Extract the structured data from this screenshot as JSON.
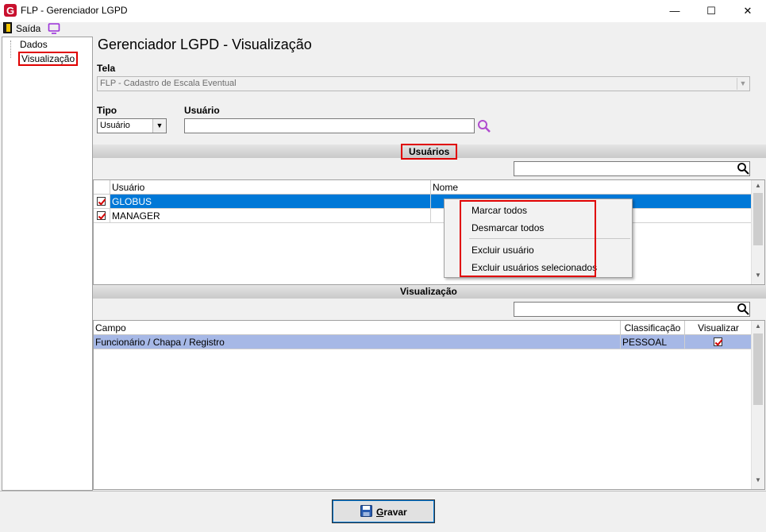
{
  "window": {
    "title": "FLP - Gerenciador LGPD",
    "minimize": "—",
    "maximize": "☐",
    "close": "✕"
  },
  "toolbar": {
    "exit_label": "Saída",
    "exit_icon": "exit-door-icon",
    "monitor_icon": "monitor-icon"
  },
  "tree": {
    "items": [
      {
        "label": "Dados",
        "selected": false
      },
      {
        "label": "Visualização",
        "selected": true
      }
    ]
  },
  "page": {
    "title": "Gerenciador LGPD - Visualização"
  },
  "form": {
    "tela_label": "Tela",
    "tela_value": "FLP - Cadastro de Escala Eventual",
    "tipo_label": "Tipo",
    "tipo_value": "Usuário",
    "usuario_label": "Usuário",
    "usuario_value": ""
  },
  "usuarios_section": {
    "title": "Usuários",
    "search_value": "",
    "columns": [
      "Usuário",
      "Nome"
    ],
    "rows": [
      {
        "checked": true,
        "usuario": "GLOBUS",
        "nome": "",
        "selected": true
      },
      {
        "checked": true,
        "usuario": "MANAGER",
        "nome": "",
        "selected": false
      }
    ]
  },
  "context_menu": {
    "items": [
      "Marcar todos",
      "Desmarcar todos",
      "Excluir usuário",
      "Excluir usuários selecionados"
    ]
  },
  "visualizacao_section": {
    "title": "Visualização",
    "search_value": "",
    "columns": [
      "Campo",
      "Classificação",
      "Visualizar"
    ],
    "rows": [
      {
        "campo": "Funcionário / Chapa / Registro",
        "classificacao": "PESSOAL",
        "visualizar": true
      }
    ]
  },
  "footer": {
    "save_label": "Gravar"
  },
  "colors": {
    "highlight_red": "#e00000",
    "row_selected": "#0078d7",
    "row_selected_vis": "#a6b8e6",
    "search_icon": "#b04ccf"
  }
}
